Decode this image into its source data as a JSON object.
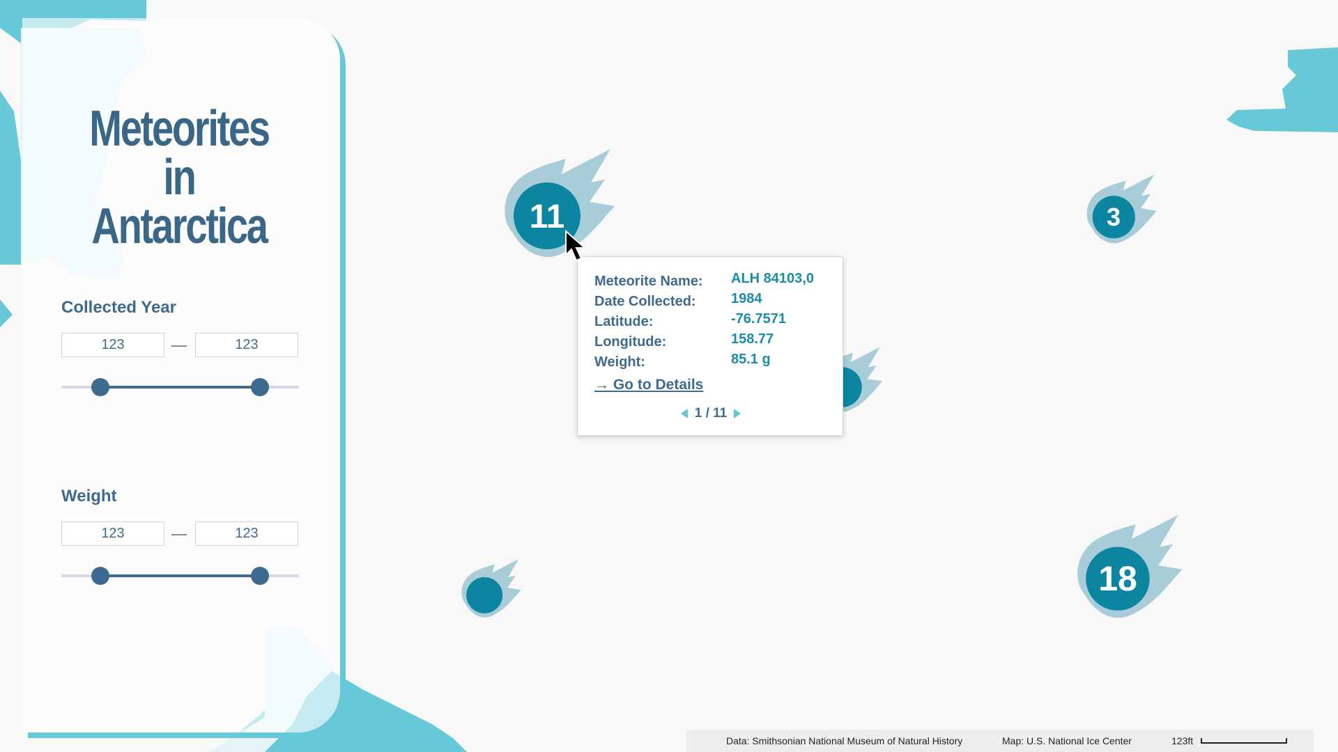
{
  "title": {
    "line1": "Meteorites",
    "line2": "in Antarctica"
  },
  "filters": {
    "collected_year": {
      "label": "Collected Year",
      "min_value": "123",
      "max_value": "123"
    },
    "weight": {
      "label": "Weight",
      "min_value": "123",
      "max_value": "123"
    }
  },
  "markers": [
    {
      "name": "cluster-11",
      "count": "11"
    },
    {
      "name": "cluster-3",
      "count": "3"
    },
    {
      "name": "cluster-18",
      "count": "18"
    },
    {
      "name": "single-meteorite-a",
      "count": ""
    },
    {
      "name": "single-meteorite-b",
      "count": ""
    }
  ],
  "popup": {
    "rows": [
      {
        "key": "Meteorite Name:",
        "value": "ALH 84103,0"
      },
      {
        "key": "Date Collected:",
        "value": "1984"
      },
      {
        "key": "Latitude:",
        "value": "-76.7571"
      },
      {
        "key": "Longitude:",
        "value": "158.77"
      },
      {
        "key": "Weight:",
        "value": "85.1 g"
      }
    ],
    "link_label": "→ Go to Details",
    "pager_text": "1 / 11"
  },
  "footer": {
    "data_credit": "Data: Smithsonian National Museum of Natural History",
    "map_credit": "Map: U.S. National Ice Center",
    "scale_label": "123ft"
  },
  "colors": {
    "ice": "#67c8d8",
    "ice_light": "#e6f5f8",
    "meteor_core": "#0b85a0",
    "meteor_tail": "#a9cdd8",
    "title": "#3a6688"
  }
}
